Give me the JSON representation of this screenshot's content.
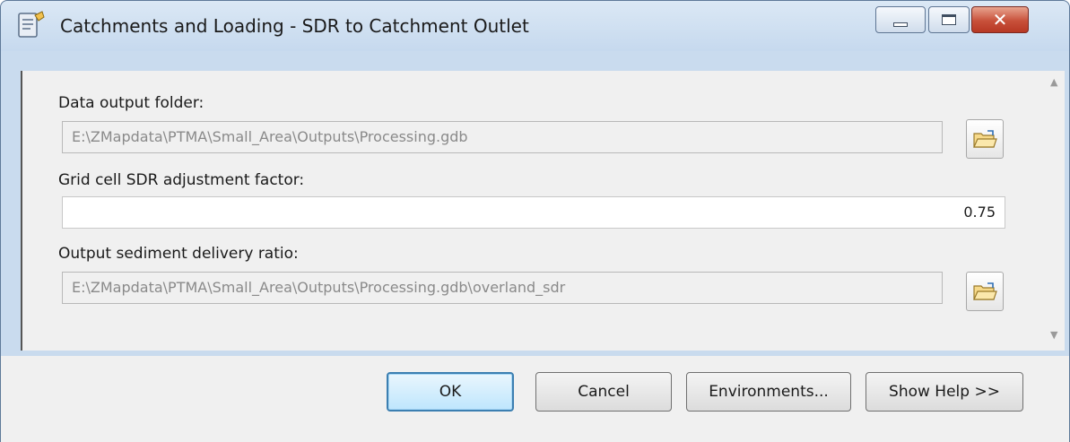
{
  "window": {
    "title": "Catchments and Loading - SDR to Catchment Outlet",
    "icon": "tool-script-icon",
    "close_glyph": "✕"
  },
  "fields": [
    {
      "label": "Data output folder:",
      "value": "E:\\ZMapdata\\PTMA\\Small_Area\\Outputs\\Processing.gdb",
      "enabled": false,
      "has_browse": true
    },
    {
      "label": "Grid cell SDR adjustment factor:",
      "value": "0.75",
      "enabled": true,
      "has_browse": false
    },
    {
      "label": "Output sediment delivery ratio:",
      "value": "E:\\ZMapdata\\PTMA\\Small_Area\\Outputs\\Processing.gdb\\overland_sdr",
      "enabled": false,
      "has_browse": true
    }
  ],
  "scrollbar": {
    "up": "▲",
    "down": "▼"
  },
  "buttons": {
    "ok": "OK",
    "cancel": "Cancel",
    "environments": "Environments...",
    "show_help": "Show Help >>"
  },
  "colors": {
    "frame": "#c9dbee",
    "default_button_border": "#3c7fb1",
    "close_button": "#c8503a"
  }
}
